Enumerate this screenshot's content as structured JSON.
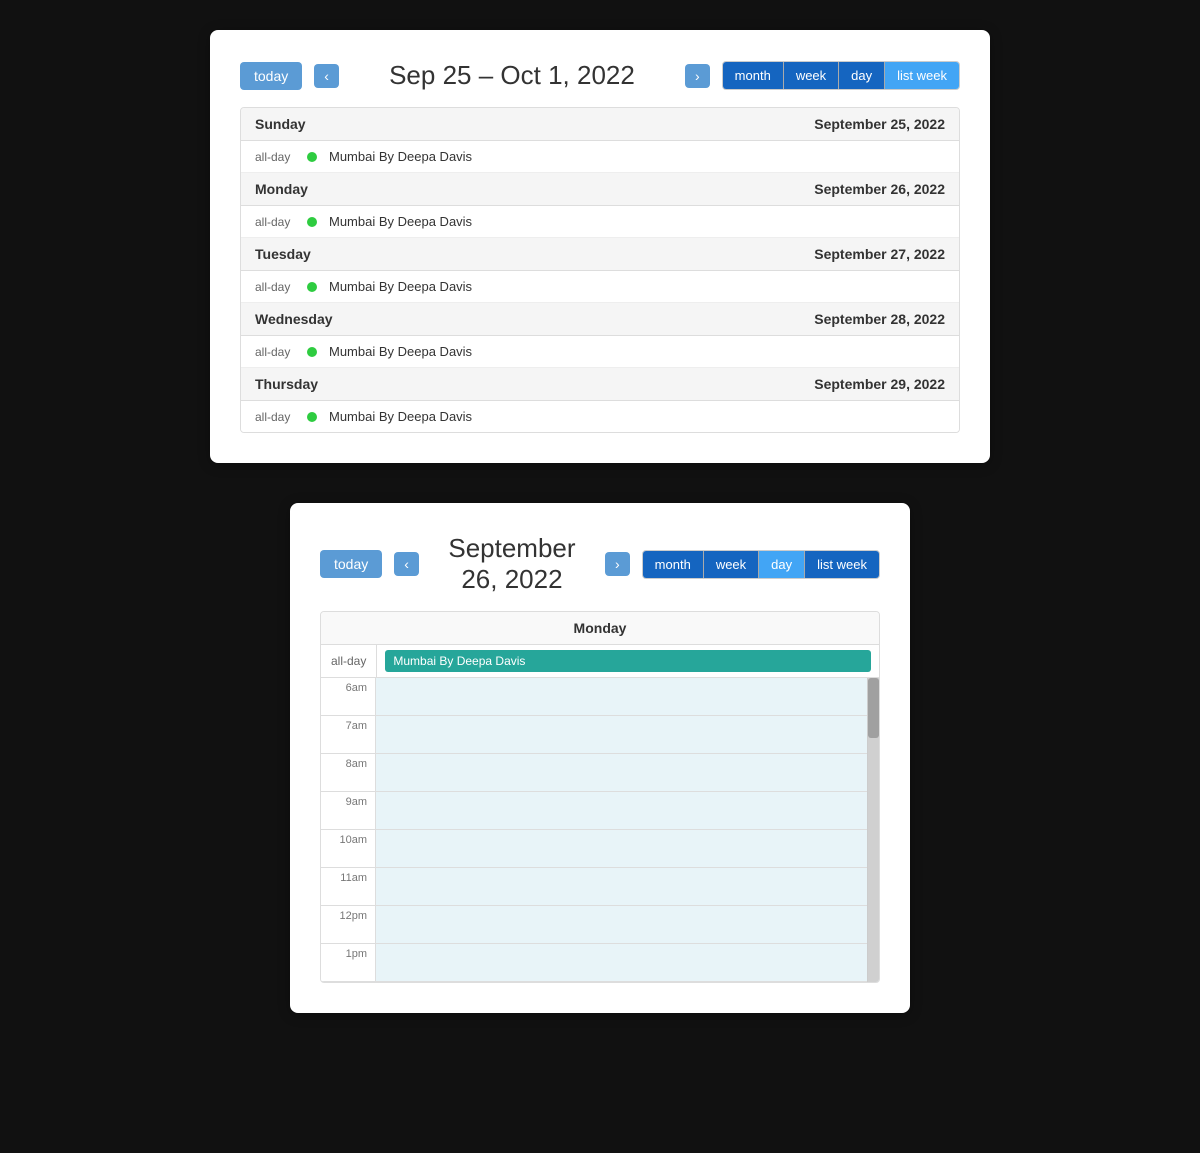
{
  "top_card": {
    "toolbar": {
      "today_label": "today",
      "prev_label": "‹",
      "next_label": "›",
      "title": "Sep 25 – Oct 1, 2022",
      "views": [
        "month",
        "week",
        "day",
        "list week"
      ],
      "active_view": "list week"
    },
    "days": [
      {
        "day_name": "Sunday",
        "day_date": "September 25, 2022",
        "events": [
          {
            "time": "all-day",
            "title": "Mumbai By Deepa Davis"
          }
        ]
      },
      {
        "day_name": "Monday",
        "day_date": "September 26, 2022",
        "events": [
          {
            "time": "all-day",
            "title": "Mumbai By Deepa Davis"
          }
        ]
      },
      {
        "day_name": "Tuesday",
        "day_date": "September 27, 2022",
        "events": [
          {
            "time": "all-day",
            "title": "Mumbai By Deepa Davis"
          }
        ]
      },
      {
        "day_name": "Wednesday",
        "day_date": "September 28, 2022",
        "events": [
          {
            "time": "all-day",
            "title": "Mumbai By Deepa Davis"
          }
        ]
      },
      {
        "day_name": "Thursday",
        "day_date": "September 29, 2022",
        "events": [
          {
            "time": "all-day",
            "title": "Mumbai By Deepa Davis"
          }
        ]
      }
    ]
  },
  "bottom_card": {
    "toolbar": {
      "today_label": "today",
      "prev_label": "‹",
      "next_label": "›",
      "title": "September 26, 2022",
      "views": [
        "month",
        "week",
        "day",
        "list week"
      ],
      "active_view": "day"
    },
    "day_header": "Monday",
    "allday_event": "Mumbai By Deepa Davis",
    "time_slots": [
      "6am",
      "7am",
      "8am",
      "9am",
      "10am",
      "11am",
      "12pm",
      "1pm"
    ]
  }
}
